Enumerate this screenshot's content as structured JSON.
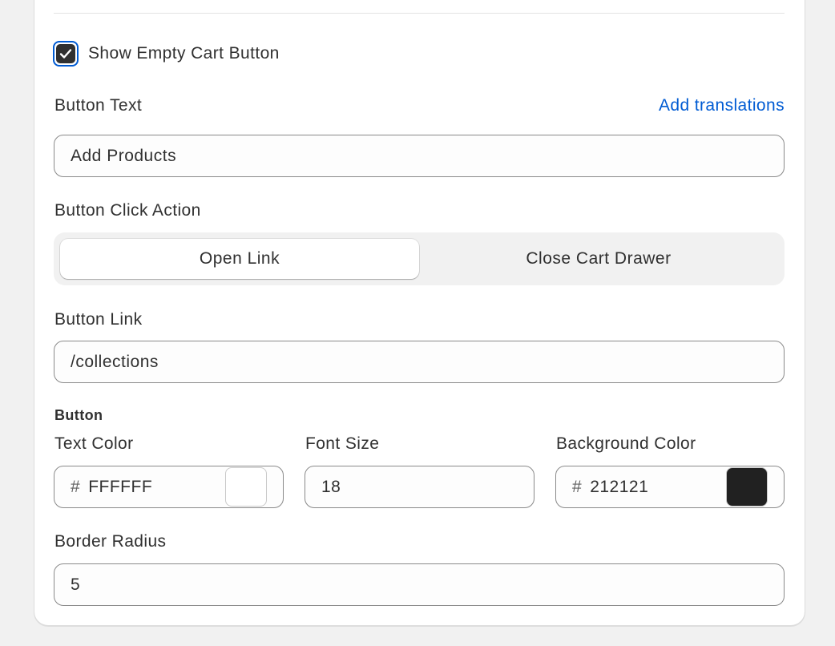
{
  "empty_cart_button": {
    "show_label": "Show Empty Cart Button",
    "show_checked": true,
    "button_text_label": "Button Text",
    "add_translations_label": "Add translations",
    "button_text_value": "Add Products",
    "click_action_label": "Button Click Action",
    "click_action_options": [
      "Open Link",
      "Close Cart Drawer"
    ],
    "click_action_selected": "Open Link",
    "button_link_label": "Button Link",
    "button_link_value": "/collections"
  },
  "button_style": {
    "section_title": "Button",
    "text_color_label": "Text Color",
    "text_color_hash": "#",
    "text_color_value": "FFFFFF",
    "text_color_swatch": "#FFFFFF",
    "font_size_label": "Font Size",
    "font_size_value": "18",
    "background_color_label": "Background Color",
    "background_color_hash": "#",
    "background_color_value": "212121",
    "background_color_swatch": "#212121",
    "border_radius_label": "Border Radius",
    "border_radius_value": "5"
  },
  "colors": {
    "accent_link": "#005bd3",
    "checkbox_focus_ring": "#005bd3",
    "page_background": "#f1f1f1"
  }
}
